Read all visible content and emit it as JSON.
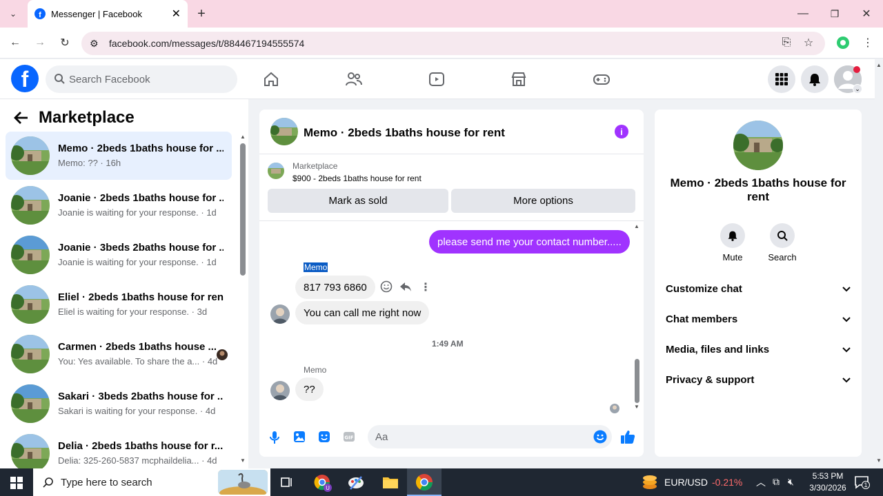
{
  "browser": {
    "tab_title": "Messenger | Facebook",
    "url": "facebook.com/messages/t/884467194555574"
  },
  "fb": {
    "search_placeholder": "Search Facebook"
  },
  "left": {
    "title": "Marketplace",
    "conversations": [
      {
        "title": "Memo · 2beds 1baths house for ...",
        "sub": "Memo: ?? · 16h",
        "active": true
      },
      {
        "title": "Joanie · 2beds 1baths house for ...",
        "sub": "Joanie is waiting for your response. · 1d"
      },
      {
        "title": "Joanie · 3beds 2baths house for ...",
        "sub": "Joanie is waiting for your response. · 1d"
      },
      {
        "title": "Eliel · 2beds 1baths house for rent",
        "sub": "Eliel is waiting for your response. · 3d"
      },
      {
        "title": "Carmen · 2beds 1baths house ...",
        "sub": "You: Yes available. To share the a... · 4d"
      },
      {
        "title": "Sakari · 3beds 2baths house for ...",
        "sub": "Sakari is waiting for your response. · 4d"
      },
      {
        "title": "Delia · 2beds 1baths house for r...",
        "sub": "Delia: 325-260-5837 mcphaildelia... · 4d"
      }
    ]
  },
  "chat": {
    "title": "Memo · 2beds 1baths house for rent",
    "listing_label": "Marketplace",
    "listing_text": "$900 - 2beds 1baths house for rent",
    "mark_sold": "Mark as sold",
    "more_options": "More options",
    "msg_me": "please send me your contact number.....",
    "sender1": "Memo",
    "msg1": "817 793 6860",
    "msg2": "You can call me right now",
    "timestamp": "1:49 AM",
    "sender2": "Memo",
    "msg3": "??",
    "input_placeholder": "Aa"
  },
  "right": {
    "title": "Memo · 2beds 1baths house for rent",
    "mute": "Mute",
    "search": "Search",
    "sections": [
      "Customize chat",
      "Chat members",
      "Media, files and links",
      "Privacy & support"
    ]
  },
  "taskbar": {
    "search_placeholder": "Type here to search",
    "ticker_name": "EUR/USD",
    "ticker_change": "-0.21%",
    "time": "5:53 PM",
    "date": "3/30/2026",
    "notif_count": "1"
  },
  "colors": {
    "accent": "#0866ff",
    "bubble_me": "#a033ff",
    "messenger_blue": "#0a7cff",
    "ticker_red": "#ff6b6b"
  }
}
